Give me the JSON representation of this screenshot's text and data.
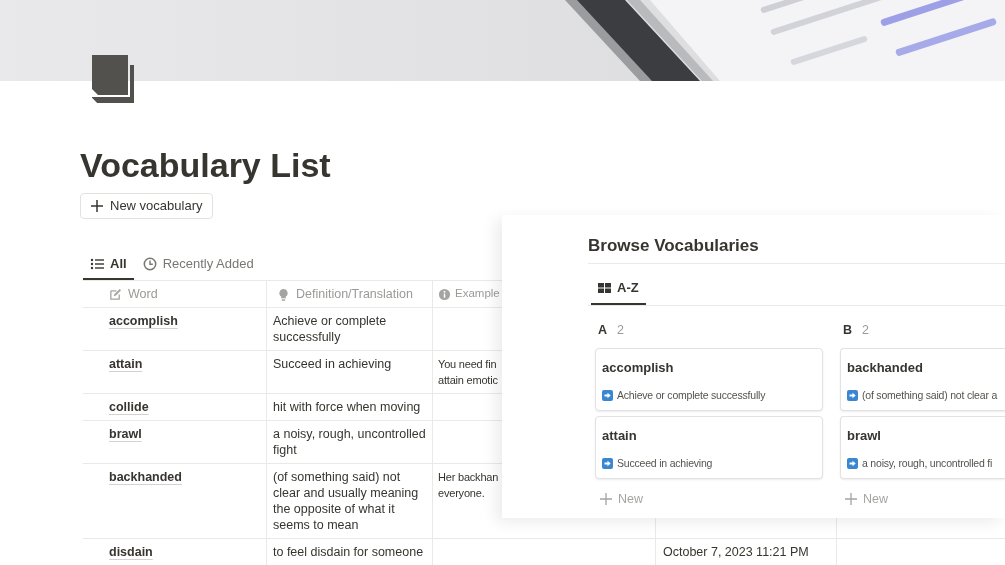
{
  "page": {
    "title": "Vocabulary List"
  },
  "new_button": {
    "label": "New vocabulary"
  },
  "views": [
    {
      "label": "All",
      "selected": true
    },
    {
      "label": "Recently Added",
      "selected": false
    }
  ],
  "table": {
    "columns": [
      {
        "label": "Word"
      },
      {
        "label": "Definition/Translation"
      },
      {
        "label": "Example"
      }
    ],
    "rows": [
      {
        "word": "accomplish",
        "definition": "Achieve or complete successfully"
      },
      {
        "word": "attain",
        "definition": "Succeed in achieving",
        "example": [
          "You need fin",
          "attain emotic"
        ]
      },
      {
        "word": "collide",
        "definition": "hit with force when moving"
      },
      {
        "word": "brawl",
        "definition": "a noisy, rough, uncontrolled fight"
      },
      {
        "word": "backhanded",
        "definition": "(of something said) not clear and usually meaning the opposite of what it seems to mean",
        "example": [
          "Her backhan",
          "everyone."
        ]
      },
      {
        "word": "disdain",
        "definition": "to feel disdain for someone",
        "date": "October 7, 2023 11:21 PM"
      }
    ]
  },
  "panel": {
    "title": "Browse Vocabularies",
    "tabs": [
      {
        "label": "A-Z",
        "selected": true
      }
    ],
    "groups": [
      {
        "label": "A",
        "count": "2",
        "new_label": "New",
        "cards": [
          {
            "title": "accomplish",
            "text": "Achieve or complete successfully"
          },
          {
            "title": "attain",
            "text": "Succeed in achieving"
          }
        ]
      },
      {
        "label": "B",
        "count": "2",
        "new_label": "New",
        "cards": [
          {
            "title": "backhanded",
            "text": "(of something said) not clear a"
          },
          {
            "title": "brawl",
            "text": "a noisy, rough, uncontrolled fi"
          }
        ]
      }
    ]
  }
}
